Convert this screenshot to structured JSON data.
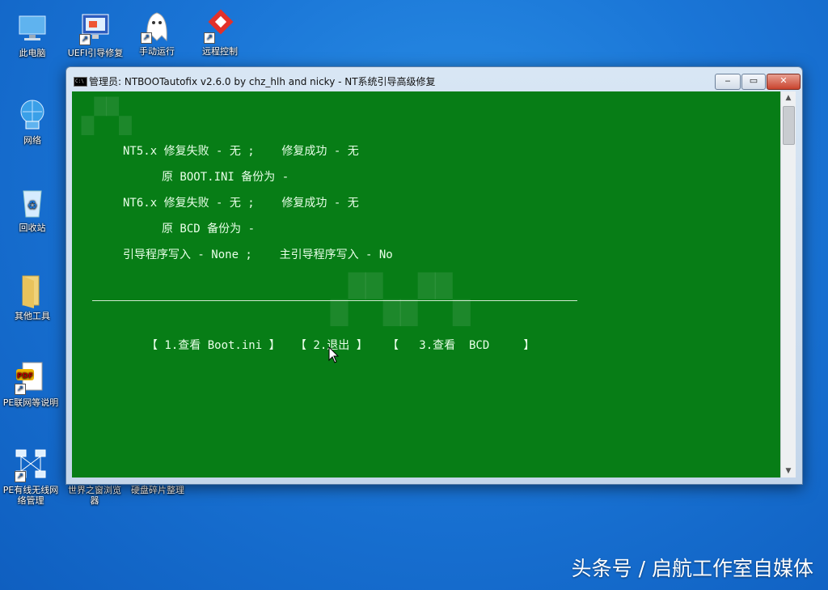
{
  "desktop": {
    "icons": [
      {
        "label": "此电脑"
      },
      {
        "label": "UEFI引导修复"
      },
      {
        "label": "手动运行"
      },
      {
        "label": "远程控制"
      },
      {
        "label": "网络"
      },
      {
        "label": "回收站"
      },
      {
        "label": "其他工具"
      },
      {
        "label": "PE联网等说明"
      },
      {
        "label": "PE有线无线网络管理"
      },
      {
        "label": "世界之窗浏览器"
      },
      {
        "label": "硬盘碎片整理"
      }
    ]
  },
  "window": {
    "title": "管理员:  NTBOOTautofix v2.6.0 by chz_hlh and nicky - NT系统引导高级修复",
    "min": "‒",
    "max": "▭",
    "close": "✕"
  },
  "console": {
    "line1": "NT5.x 修复失败 - 无 ;    修复成功 - 无",
    "line2": "原 BOOT.INI 备份为 -",
    "line3": "NT6.x 修复失败 - 无 ;    修复成功 - 无",
    "line4": "原 BCD 备份为 -",
    "line5": "引导程序写入 - None ;    主引导程序写入 - No",
    "separator": "————————————————————————————————————————————————————————————————————————————",
    "menu": {
      "item1": "【 1.查看 Boot.ini 】",
      "item2": "【 2.退出 】",
      "item3": "【   3.查看  BCD     】"
    }
  },
  "footer_watermark": "头条号 / 启航工作室自媒体"
}
